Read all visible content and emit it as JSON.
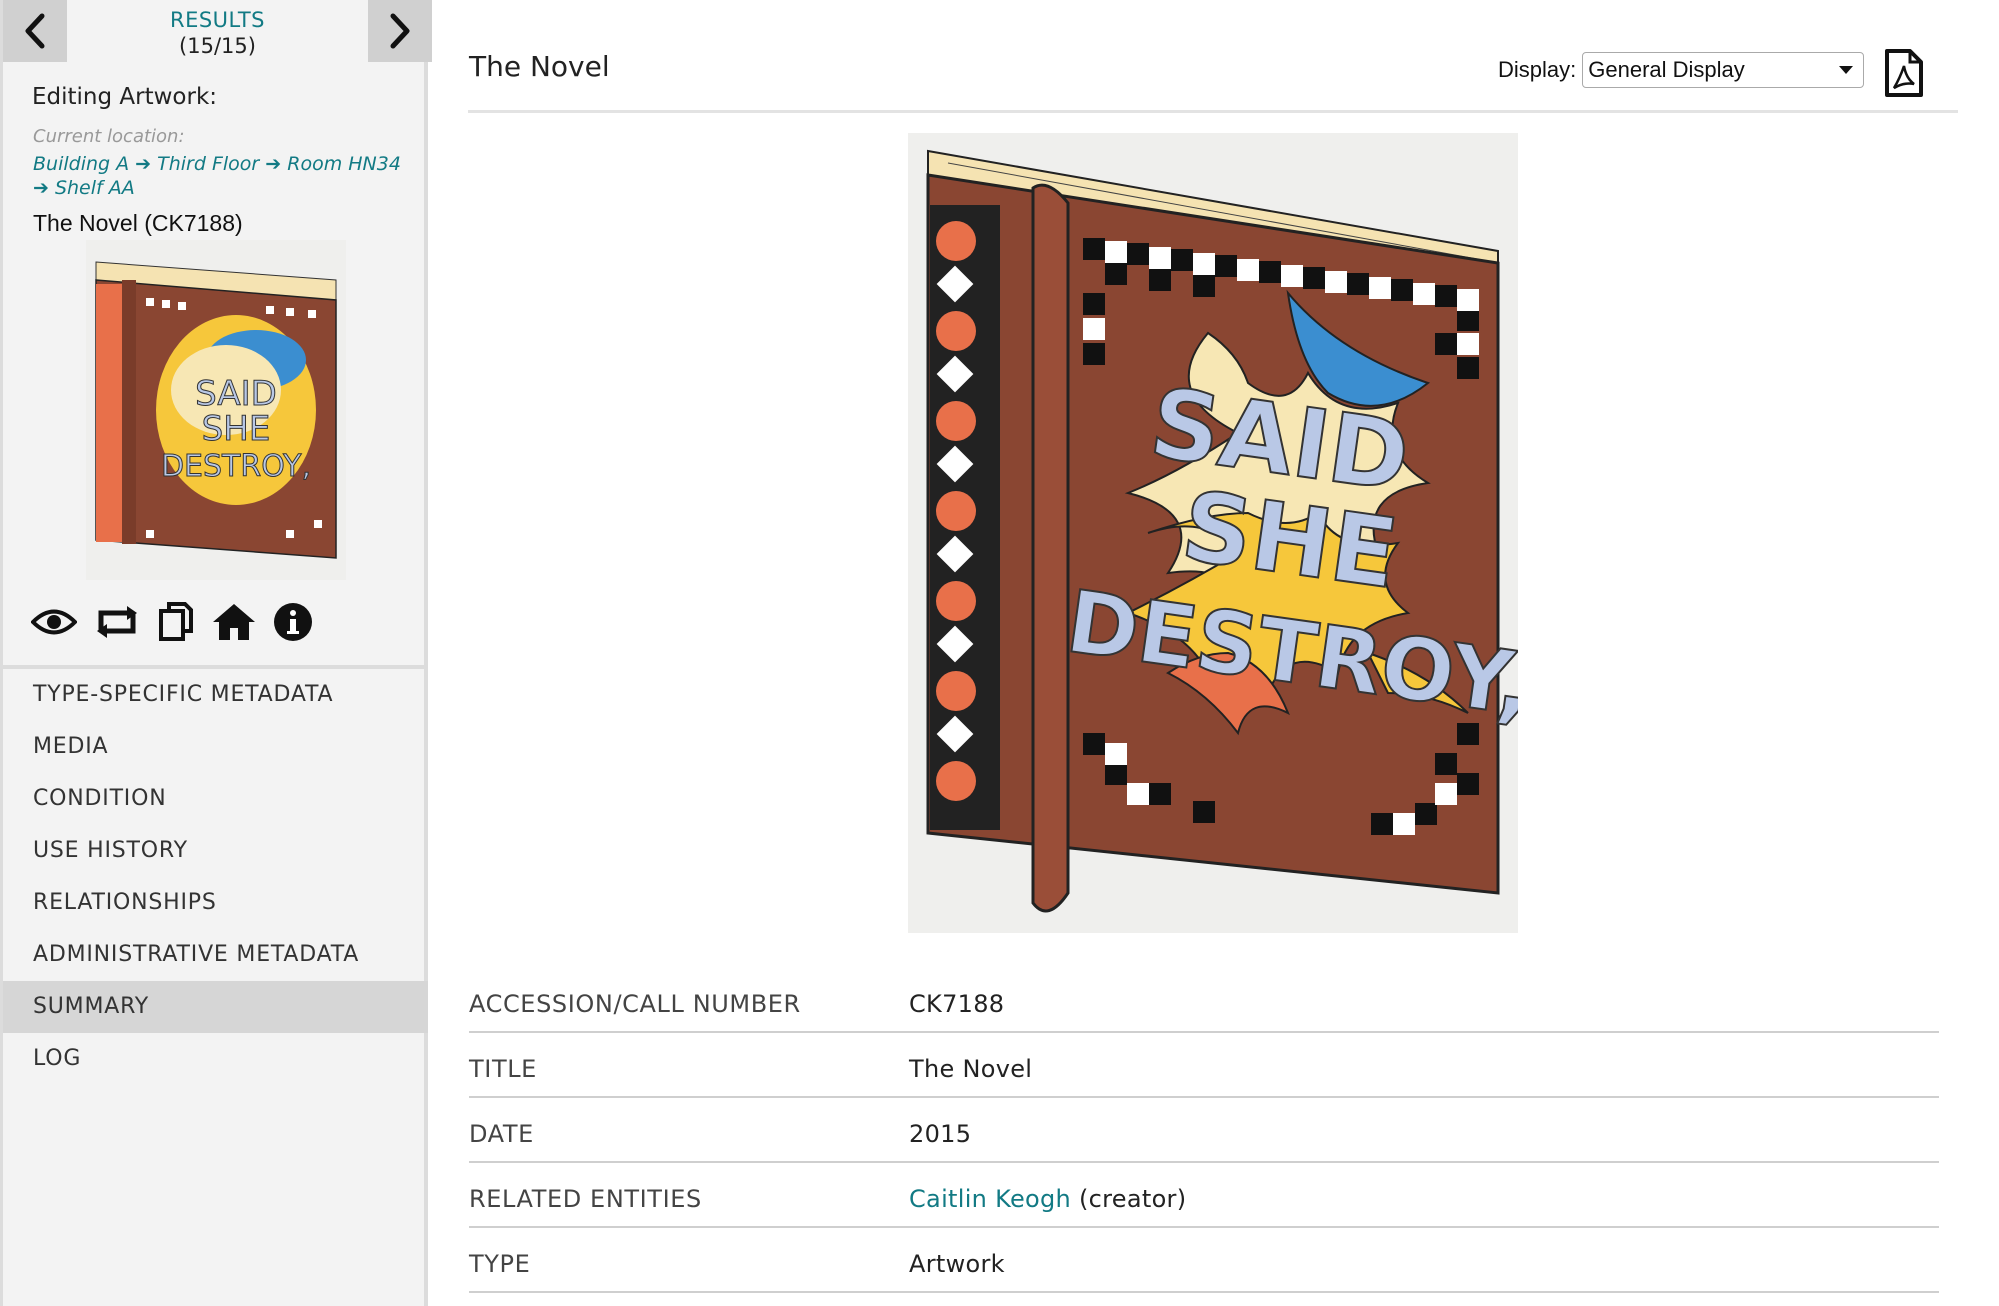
{
  "sidebar": {
    "results_label": "RESULTS",
    "results_count": "(15/15)",
    "editing_label": "Editing Artwork:",
    "current_location_label": "Current location:",
    "location_path": [
      "Building A",
      "➔ Third Floor",
      "➔ Room HN34",
      "➔ Shelf AA"
    ],
    "object_title": "The Novel (CK7188)",
    "tools": [
      "eye-icon",
      "repeat-icon",
      "copy-icon",
      "home-icon",
      "info-icon"
    ],
    "menu": [
      {
        "label": "TYPE-SPECIFIC METADATA",
        "active": false
      },
      {
        "label": "MEDIA",
        "active": false
      },
      {
        "label": "CONDITION",
        "active": false
      },
      {
        "label": "USE HISTORY",
        "active": false
      },
      {
        "label": "RELATIONSHIPS",
        "active": false
      },
      {
        "label": "ADMINISTRATIVE METADATA",
        "active": false
      },
      {
        "label": "SUMMARY",
        "active": true
      },
      {
        "label": "LOG",
        "active": false
      }
    ]
  },
  "main": {
    "title": "The Novel",
    "display_label": "Display:",
    "display_value": "General Display",
    "pdf_icon": "pdf-icon",
    "artwork_text": [
      "SAID",
      "SHE",
      "DESTROY,"
    ],
    "metadata": [
      {
        "label": "ACCESSION/CALL NUMBER",
        "value": "CK7188"
      },
      {
        "label": "TITLE",
        "value": "The Novel"
      },
      {
        "label": "DATE",
        "value": "2015"
      },
      {
        "label": "RELATED ENTITIES",
        "link": "Caitlin Keogh",
        "suffix": " (creator)"
      },
      {
        "label": "TYPE",
        "value": "Artwork"
      }
    ]
  },
  "colors": {
    "accent": "#127a84",
    "book_brown": "#8a4632",
    "salmon": "#e8704a",
    "cream": "#f7e7b4",
    "yellow": "#f6c73b",
    "blue": "#3b8ed0",
    "light_blue": "#b9c8e6"
  }
}
